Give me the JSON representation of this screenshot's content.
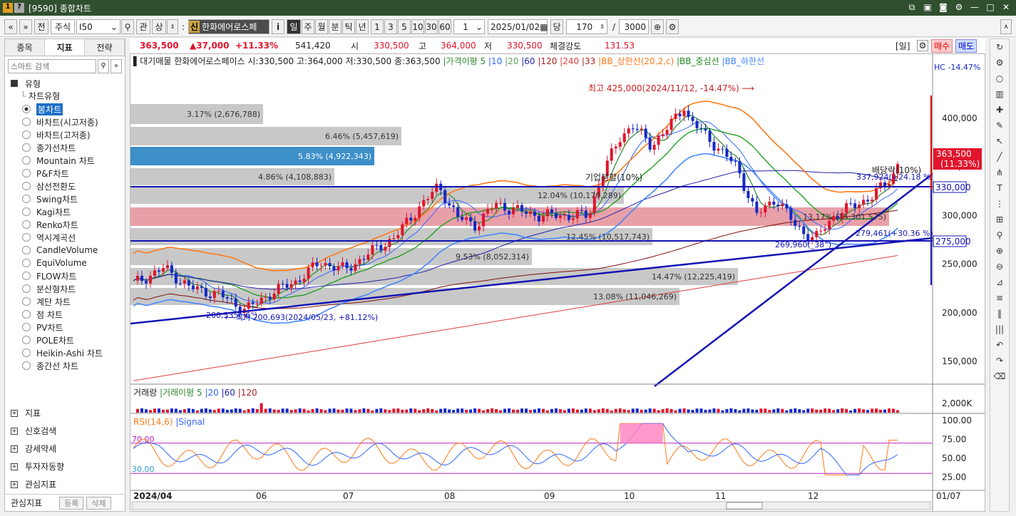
{
  "window": {
    "num": "1",
    "help": "?",
    "title": "[9590] 종합차트"
  },
  "toolbar": {
    "nav_prev": "«",
    "nav_next": "»",
    "jeon": "전",
    "market": "주식",
    "code": "I50",
    "gwan": "관",
    "sang": "상",
    "sin_badge": "신",
    "stock_name": "한화에어로스페",
    "info": "i",
    "periods": [
      "일",
      "주",
      "월",
      "분",
      "틱",
      "년"
    ],
    "nums": [
      "1",
      "3",
      "5",
      "10",
      "30",
      "60"
    ],
    "unit": "1",
    "date": "2025/01/02",
    "dang": "당",
    "count": "170",
    "slash": "/",
    "total": "3000"
  },
  "lefttabs": [
    "종목",
    "지표",
    "전략"
  ],
  "search_placeholder": "스마트 검색",
  "tree": {
    "header": "유형",
    "sub": "차트유형",
    "types": [
      "봉차트",
      "바차트(시고저종)",
      "바차트(고저종)",
      "종가선차트",
      "Mountain 차트",
      "P&F차트",
      "삼선전환도",
      "Swing차트",
      "Kagi차트",
      "Renko차트",
      "역시계곡선",
      "CandleVolume",
      "EquiVolume",
      "FLOW차트",
      "분산형차트",
      "계단 차트",
      "점 차트",
      "PV차트",
      "POLE차트",
      "Heikin-Ashi 차트",
      "종간선 차트"
    ],
    "selected": "봉차트"
  },
  "sections": [
    "지표",
    "신호검색",
    "강세약세",
    "투자자동향",
    "관심지표"
  ],
  "left_bottom": {
    "label": "관심지표",
    "btn1": "등록",
    "btn2": "삭제"
  },
  "quote": {
    "price": "363,500",
    "change": "▲37,000",
    "rate": "+11.33%",
    "volume": "541,420",
    "open_label": "시",
    "open": "330,500",
    "high_label": "고",
    "high": "364,000",
    "low_label": "저",
    "low": "330,500",
    "strength_label": "체결강도",
    "strength": "131.53",
    "il": "[일]",
    "buy": "매수",
    "sell": "매도"
  },
  "legend": {
    "prefix": "대기매물",
    "name": "한화에어로스페이스",
    "ohlc": "시:330,500 고:364,000 저:330,500 종:363,500",
    "ma": "가격이평 5",
    "ma10": "10",
    "ma20": "20",
    "ma60": "60",
    "ma120": "120",
    "ma240": "240",
    "ma33": "33",
    "bb_up": "BB_상한선(20,2,c)",
    "bb_mid": "BB_중심선",
    "bb_low": "BB_하한선",
    "hc": "HC -14.47%"
  },
  "colors": {
    "up": "#e0142c",
    "down": "#1428c8",
    "ma5": "#2e8b2e",
    "ma10": "#3366ff",
    "ma20": "#228b22",
    "bb_up": "#ff7a1a",
    "bb_low": "#4488ff",
    "red_band": "#e8a0a8",
    "blue_band": "#3c8fc8",
    "grey_band": "#c8c8c8",
    "rsi": "#ff7a1a",
    "signal": "#3366ff",
    "rsi_fill": "#ff80c0"
  },
  "annotations": {
    "high": "최고 425,000(2024/11/12, -14.47%)",
    "low": "최저 200,693(2024/05/23, +81.12%)",
    "split": "기업분할(10%)",
    "dividend": "배당락(10%)",
    "low_tl": "200,535(_6°)",
    "tl2": "269,960(_38°)",
    "tl3": "279,461(+30.36 %)",
    "div_pct": "337,924(+24.18 %)"
  },
  "price_axis": {
    "ticks": [
      "400,000",
      "350,000",
      "300,000",
      "250,000",
      "200,000",
      "150,000"
    ],
    "current": "363,500",
    "current_pct": "(11.33%)",
    "h1": "330,000",
    "h2": "275,000"
  },
  "bands": [
    {
      "label": "3.17% (2,676,788)",
      "kind": "grey"
    },
    {
      "label": "6.46% (5,457,619)",
      "kind": "grey"
    },
    {
      "label": "5.83% (4,922,343)",
      "kind": "blue"
    },
    {
      "label": "4.86% (4,108,883)",
      "kind": "grey"
    },
    {
      "label": "12.04% (10,170,289)",
      "kind": "grey"
    },
    {
      "label": "13.17% (15,301,575)",
      "kind": "red"
    },
    {
      "label": "12.45% (10,517,743)",
      "kind": "grey"
    },
    {
      "label": "9.53% (8,052,314)",
      "kind": "grey"
    },
    {
      "label": "14.47% (12,225,419)",
      "kind": "grey"
    },
    {
      "label": "13.08% (11,046,269)",
      "kind": "grey"
    }
  ],
  "volume": {
    "title": "거래량",
    "ma": "거래이평 5",
    "ma20": "20",
    "ma60": "60",
    "ma120": "120",
    "axis": "2,000K"
  },
  "rsi": {
    "title": "RSI(14,6)",
    "signal": "Signal",
    "l70": "70.00",
    "l30": "30.00",
    "ticks": [
      "100.00",
      "75.00",
      "50.00",
      "25.00"
    ]
  },
  "xaxis": {
    "labels": [
      "2024/04",
      "06",
      "07",
      "08",
      "09",
      "10",
      "11",
      "12",
      "01/07"
    ]
  }
}
